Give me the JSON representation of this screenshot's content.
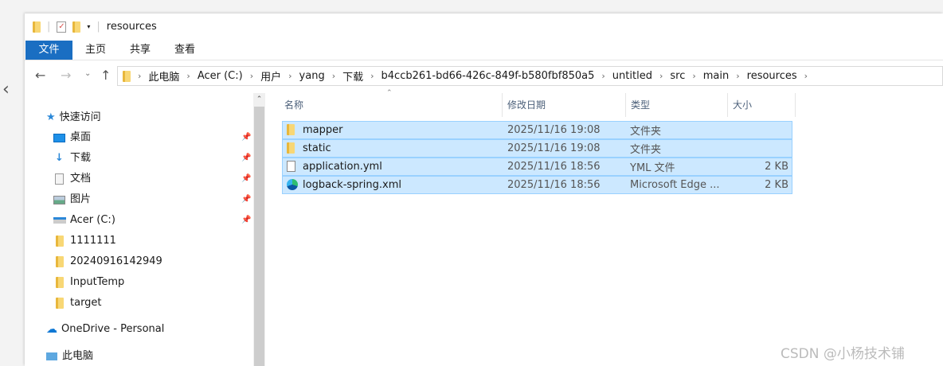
{
  "window": {
    "title": "resources"
  },
  "ribbon": {
    "tabs": [
      "文件",
      "主页",
      "共享",
      "查看"
    ]
  },
  "address": {
    "crumbs": [
      "此电脑",
      "Acer (C:)",
      "用户",
      "yang",
      "下载",
      "b4ccb261-bd66-426c-849f-b580fbf850a5",
      "untitled",
      "src",
      "main",
      "resources"
    ]
  },
  "sidebar": {
    "quick_access": "快速访问",
    "items": [
      {
        "label": "桌面",
        "icon": "desktop-icon",
        "pinned": true
      },
      {
        "label": "下载",
        "icon": "download-icon",
        "pinned": true
      },
      {
        "label": "文档",
        "icon": "documents-icon",
        "pinned": true
      },
      {
        "label": "图片",
        "icon": "pictures-icon",
        "pinned": true
      },
      {
        "label": "Acer (C:)",
        "icon": "drive-icon",
        "pinned": true
      },
      {
        "label": "1111111",
        "icon": "folder-icon",
        "pinned": false
      },
      {
        "label": "20240916142949",
        "icon": "folder-icon",
        "pinned": false
      },
      {
        "label": "InputTemp",
        "icon": "folder-icon",
        "pinned": false
      },
      {
        "label": "target",
        "icon": "folder-icon",
        "pinned": false
      }
    ],
    "onedrive": "OneDrive - Personal",
    "this_pc": "此电脑"
  },
  "columns": {
    "name": "名称",
    "date": "修改日期",
    "type": "类型",
    "size": "大小"
  },
  "files": [
    {
      "name": "mapper",
      "date": "2025/11/16 19:08",
      "type": "文件夹",
      "size": "",
      "icon": "folder-icon"
    },
    {
      "name": "static",
      "date": "2025/11/16 19:08",
      "type": "文件夹",
      "size": "",
      "icon": "folder-icon"
    },
    {
      "name": "application.yml",
      "date": "2025/11/16 18:56",
      "type": "YML 文件",
      "size": "2 KB",
      "icon": "file-icon"
    },
    {
      "name": "logback-spring.xml",
      "date": "2025/11/16 18:56",
      "type": "Microsoft Edge ...",
      "size": "2 KB",
      "icon": "edge-icon"
    }
  ],
  "watermark": "CSDN @小杨技术铺"
}
